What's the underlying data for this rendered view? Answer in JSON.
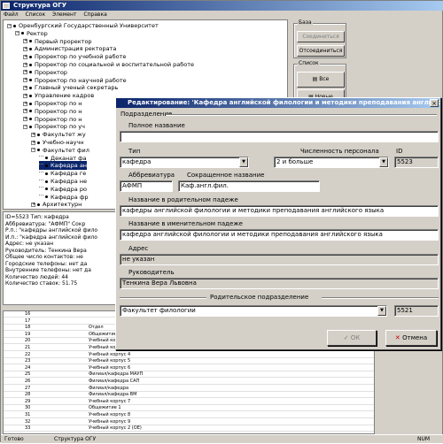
{
  "window": {
    "title": "Структура ОГУ"
  },
  "menu": [
    "Файл",
    "Список",
    "Элемент",
    "Справка"
  ],
  "tree": [
    {
      "text": "Оренбургский Государственный Университет",
      "level": 0
    },
    {
      "text": "Ректор",
      "level": 1
    },
    {
      "text": "Первый проректор",
      "level": 2
    },
    {
      "text": "Администрация ректората",
      "level": 2
    },
    {
      "text": "Проректор по учебной работе",
      "level": 2
    },
    {
      "text": "Проректор по социальной и воспитательной работе",
      "level": 2
    },
    {
      "text": "Проректор",
      "level": 2
    },
    {
      "text": "Проректор по научной работе",
      "level": 2
    },
    {
      "text": "Главный ученый секретарь",
      "level": 2
    },
    {
      "text": "Управление кадров",
      "level": 2
    },
    {
      "text": "Проректор по н",
      "level": 2
    },
    {
      "text": "Проректор по н",
      "level": 2
    },
    {
      "text": "Проректор по н",
      "level": 2
    },
    {
      "text": "Проректор по уч",
      "level": 2
    },
    {
      "text": "Факультет жу",
      "level": 3
    },
    {
      "text": "Учебно-научн",
      "level": 3
    },
    {
      "text": "Факультет фил",
      "level": 3
    },
    {
      "text": "Деканат фа",
      "level": 4
    },
    {
      "text": "Кафедра ан",
      "level": 4
    },
    {
      "text": "Кафедра ге",
      "level": 4
    },
    {
      "text": "Кафедра не",
      "level": 4
    },
    {
      "text": "Кафедра ро",
      "level": 4
    },
    {
      "text": "Кафедра фр",
      "level": 4
    },
    {
      "text": "Архитектурн",
      "level": 3
    }
  ],
  "right": {
    "base_title": "База",
    "connect_label": "Соединиться",
    "disconnect_label": "Отсоединиться",
    "list_title": "Список",
    "all_label": "Все",
    "new_label": "Новые"
  },
  "info_lines": [
    "ID=5523   Тип: кафедра",
    "Аббревиатура: \"АФМП\"   Сокр",
    "Р.п.: \"кафедры английской фило",
    "И.п.: \"кафедра английской фило",
    "Адрес: не указан",
    "Руководитель: Тенкина Вера",
    "Общее число контактов: не",
    "Городские телефоны: нет да",
    "Внутренние телефоны: нет да",
    "Количество людей: 44",
    "Количество ставок: 51.75"
  ],
  "grid_rows": [
    "Отдел",
    "Общежитие 5",
    "Учебный корпус 2",
    "Учебный корпус 3",
    "Учебный корпус 4",
    "Учебный корпус 5",
    "Учебный корпус 6",
    "Филиал/кафедра МАУП",
    "Филиал/кафедра САП",
    "Филиал/кафедра",
    "Филиал/кафедра ВМ",
    "Учебный корпус 7",
    "Общежитие 1",
    "Учебный корпус 8",
    "Учебный корпус 9",
    "Учебный корпус 2 (ОЕ)"
  ],
  "grid_row_numbers": [
    "16",
    "17",
    "18",
    "19",
    "20",
    "21",
    "22",
    "23",
    "24",
    "25",
    "26",
    "27",
    "28",
    "29",
    "30",
    "31",
    "32",
    "33"
  ],
  "status": {
    "left": "Готово",
    "tab": "Структура ОГУ",
    "num": "NUM"
  },
  "dialog": {
    "title": "Редактирование: 'Кафедра английской филологии и методики преподавания английского языка'",
    "section_label": "Подразделение",
    "full_name_label": "Полное название",
    "full_name_value": "",
    "type_label": "Тип",
    "type_value": "кафедра",
    "staff_label": "Численность персонала",
    "staff_value": "2 и больше",
    "id_label": "ID",
    "id_value": "5523",
    "abbr_label": "Аббревиатура",
    "abbr_value": "АФМП",
    "short_label": "Сокращенное название",
    "short_value": "Каф.англ.фил.",
    "genitive_label": "Название в родительном падеже",
    "genitive_value": "кафедры английской филологии и методики преподавания английского языка",
    "nominative_label": "Название в именительном падеже",
    "nominative_value": "кафедра английской филологии и методики преподавания английского языка",
    "address_label": "Адрес",
    "address_value": "не указан",
    "head_label": "Руководитель",
    "head_value": "Тенкина Вера Львовна",
    "parent_label": "Родительское подразделение",
    "parent_value": "Факультет филологии",
    "parent_id": "5521",
    "ok_label": "ОК",
    "cancel_label": "Отмена"
  }
}
